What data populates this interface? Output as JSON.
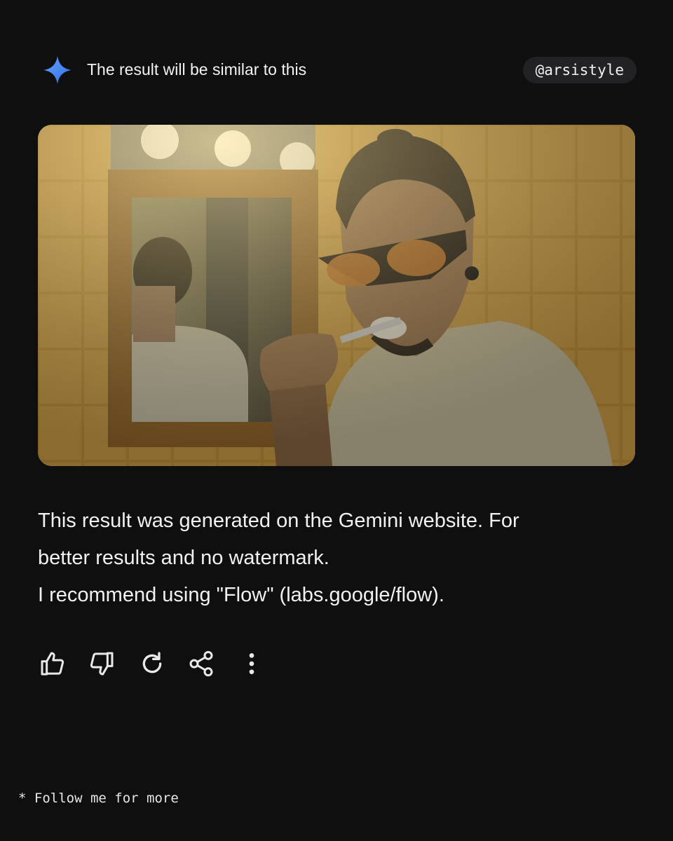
{
  "header": {
    "icon": "gemini-sparkle-icon",
    "title": "The result will be similar to this",
    "handle": "@arsistyle"
  },
  "colors": {
    "background": "#0f0f10",
    "sparkle_gradient": [
      "#4f8df7",
      "#2b6fe6"
    ],
    "handle_pill": "#222224",
    "text": "#f1f1f1"
  },
  "image": {
    "icon": "generated-photo-man-brushing-teeth-bathroom"
  },
  "body": {
    "line1": "This result was generated on the Gemini website. For",
    "line2": "better results and no watermark.",
    "line3": "I recommend using \"Flow\" (labs.google/flow)."
  },
  "actions": [
    {
      "icon": "thumbs-up-icon"
    },
    {
      "icon": "thumbs-down-icon"
    },
    {
      "icon": "redo-icon"
    },
    {
      "icon": "share-icon"
    },
    {
      "icon": "more-vertical-icon"
    }
  ],
  "footer": {
    "text": "* Follow me for more"
  }
}
